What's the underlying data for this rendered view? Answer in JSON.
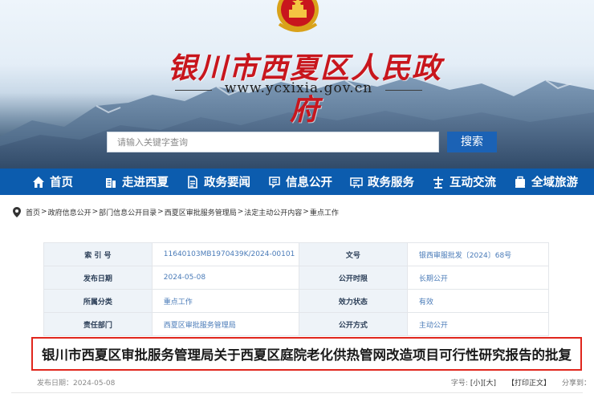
{
  "header": {
    "site_title": "银川市西夏区人民政府",
    "site_url": "www.ycxixia.gov.cn"
  },
  "search": {
    "placeholder": "请输入关键字查询",
    "button_label": "搜索"
  },
  "nav": {
    "items": [
      {
        "label": "首页",
        "icon": "home-icon"
      },
      {
        "label": "走进西夏",
        "icon": "building-icon"
      },
      {
        "label": "政务要闻",
        "icon": "document-icon"
      },
      {
        "label": "信息公开",
        "icon": "info-icon"
      },
      {
        "label": "政务服务",
        "icon": "service-icon"
      },
      {
        "label": "互动交流",
        "icon": "interaction-icon"
      },
      {
        "label": "全域旅游",
        "icon": "tourism-icon"
      }
    ]
  },
  "breadcrumb": {
    "items": [
      "首页",
      "政府信息公开",
      "部门信息公开目录",
      "西夏区审批服务管理局",
      "法定主动公开内容",
      "重点工作"
    ],
    "separator": ">"
  },
  "info": {
    "index_label": "索 引 号",
    "index_value": "11640103MB1970439K/2024-00101",
    "doc_no_label": "文号",
    "doc_no_value": "银西审服批发〔2024〕68号",
    "pub_date_label": "发布日期",
    "pub_date_value": "2024-05-08",
    "disclosure_label": "公开时限",
    "disclosure_value": "长期公开",
    "category_label": "所属分类",
    "category_value": "重点工作",
    "validity_label": "效力状态",
    "validity_value": "有效",
    "dept_label": "责任部门",
    "dept_value": "西夏区审批服务管理局",
    "method_label": "公开方式",
    "method_value": "主动公开"
  },
  "article": {
    "title": "银川市西夏区审批服务管理局关于西夏区庭院老化供热管网改造项目可行性研究报告的批复",
    "date_line": "发布日期：2024-05-08",
    "font_size_label": "字号:",
    "font_small": "[小]",
    "font_large": "[大]",
    "print_label": "【打印正文】",
    "share_label": "分享到："
  },
  "colors": {
    "nav_bg": "#0c5cae",
    "search_button": "#1b62b5",
    "title_red": "#c8161d",
    "highlight_border": "#e0261d"
  }
}
